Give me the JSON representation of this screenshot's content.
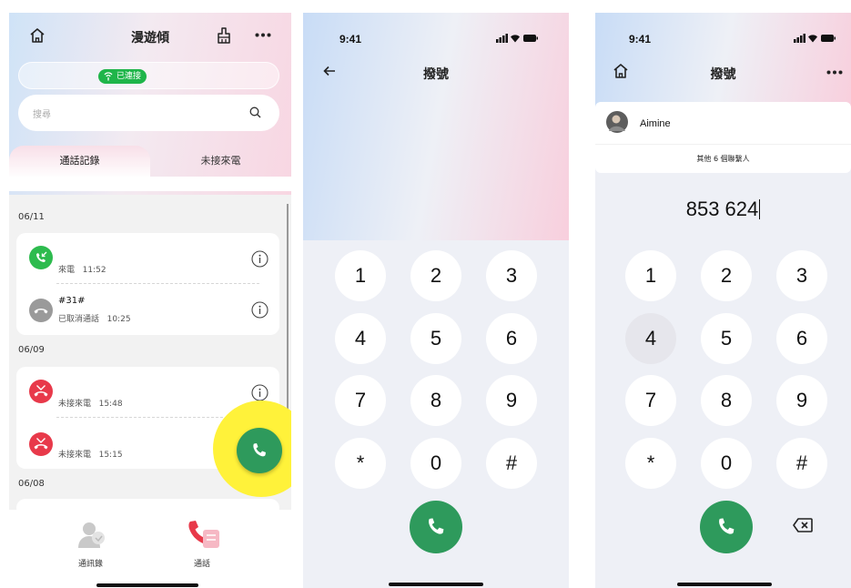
{
  "screen1": {
    "title": "漫遊傾",
    "connection_badge": "已連接",
    "search_placeholder": "搜尋",
    "tabs": [
      {
        "label": "通話記錄"
      },
      {
        "label": "未接來電"
      }
    ],
    "groups": [
      {
        "date": "06/11",
        "calls": [
          {
            "name": "",
            "status": "來電",
            "time": "11:52",
            "type": "incoming"
          },
          {
            "name": "#31#",
            "status": "已取消通話",
            "time": "10:25",
            "type": "cancelled"
          }
        ]
      },
      {
        "date": "06/09",
        "calls": [
          {
            "name": "",
            "status": "未接來電",
            "time": "15:48",
            "type": "missed"
          },
          {
            "name": "",
            "status": "未接來電",
            "time": "15:15",
            "type": "missed"
          }
        ]
      },
      {
        "date": "06/08",
        "calls": []
      }
    ],
    "nav": [
      {
        "label": "通訊錄"
      },
      {
        "label": "通話"
      }
    ],
    "colors": {
      "incoming": "#2dbb4e",
      "missed": "#e8394a",
      "cancelled": "#9a9a9a",
      "call_button": "#2e9a5c",
      "highlight": "#fff23a"
    }
  },
  "screen2": {
    "status_time": "9:41",
    "title": "撥號",
    "keys": [
      "1",
      "2",
      "3",
      "4",
      "5",
      "6",
      "7",
      "8",
      "9",
      "*",
      "0",
      "#"
    ]
  },
  "screen3": {
    "status_time": "9:41",
    "title": "撥號",
    "contact_name": "Aimine",
    "more_contacts": "其他 6 個聯繫人",
    "dialed_number": "853 624",
    "keys": [
      "1",
      "2",
      "3",
      "4",
      "5",
      "6",
      "7",
      "8",
      "9",
      "*",
      "0",
      "#"
    ],
    "pressed_key": "4"
  }
}
